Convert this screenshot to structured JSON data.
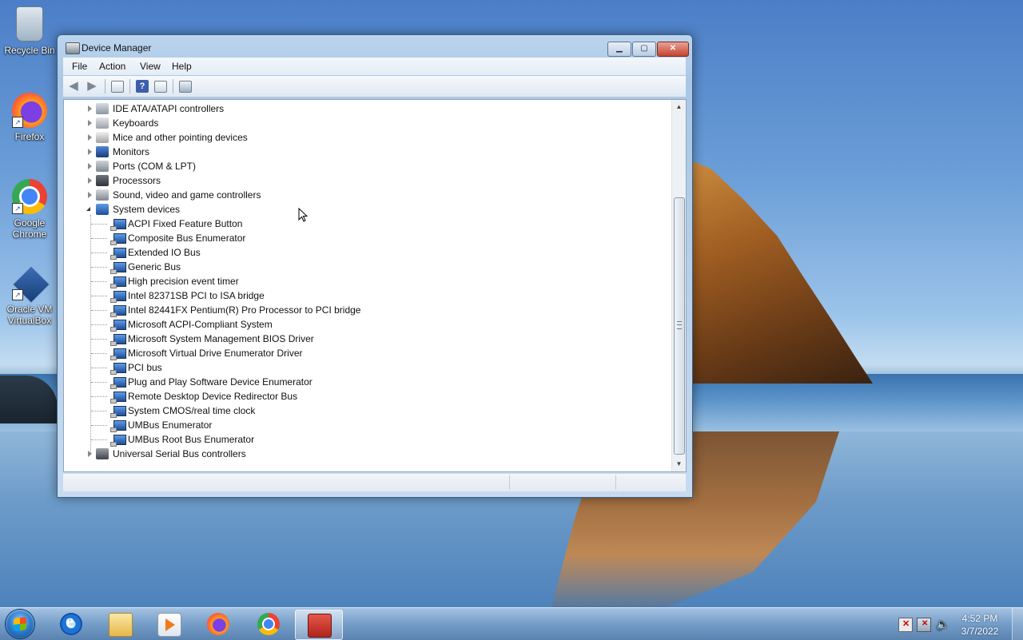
{
  "desktop": {
    "icons": [
      {
        "label": "Recycle Bin"
      },
      {
        "label": "Firefox"
      },
      {
        "label": "Google Chrome"
      },
      {
        "label": "Oracle VM VirtualBox"
      }
    ]
  },
  "window": {
    "title": "Device Manager",
    "menu": [
      "File",
      "Action",
      "View",
      "Help"
    ],
    "toolbar_icons": [
      "back-icon",
      "forward-icon",
      "properties-icon",
      "help-icon",
      "view-icon",
      "scan-hardware-icon"
    ],
    "tree": {
      "categories_before": [
        {
          "label": "IDE ATA/ATAPI controllers",
          "icon": "ide-controller-icon"
        },
        {
          "label": "Keyboards",
          "icon": "keyboard-icon"
        },
        {
          "label": "Mice and other pointing devices",
          "icon": "mouse-icon"
        },
        {
          "label": "Monitors",
          "icon": "monitor-icon"
        },
        {
          "label": "Ports (COM & LPT)",
          "icon": "port-icon"
        },
        {
          "label": "Processors",
          "icon": "processor-icon"
        },
        {
          "label": "Sound, video and game controllers",
          "icon": "speaker-icon"
        }
      ],
      "expanded_category": {
        "label": "System devices",
        "icon": "system-devices-icon"
      },
      "system_devices": [
        "ACPI Fixed Feature Button",
        "Composite Bus Enumerator",
        "Extended IO Bus",
        "Generic Bus",
        "High precision event timer",
        "Intel 82371SB PCI to ISA bridge",
        "Intel 82441FX Pentium(R) Pro Processor to PCI bridge",
        "Microsoft ACPI-Compliant System",
        "Microsoft System Management BIOS Driver",
        "Microsoft Virtual Drive Enumerator Driver",
        "PCI bus",
        "Plug and Play Software Device Enumerator",
        "Remote Desktop Device Redirector Bus",
        "System CMOS/real time clock",
        "UMBus Enumerator",
        "UMBus Root Bus Enumerator"
      ],
      "categories_after": [
        {
          "label": "Universal Serial Bus controllers",
          "icon": "usb-icon"
        }
      ]
    },
    "status_text": ""
  },
  "taskbar": {
    "apps": [
      {
        "name": "internet-explorer"
      },
      {
        "name": "file-explorer"
      },
      {
        "name": "media-player"
      },
      {
        "name": "firefox"
      },
      {
        "name": "chrome"
      },
      {
        "name": "device-manager-toolbox",
        "active": true
      }
    ],
    "clock": {
      "time": "4:52 PM",
      "date": "3/7/2022"
    }
  }
}
